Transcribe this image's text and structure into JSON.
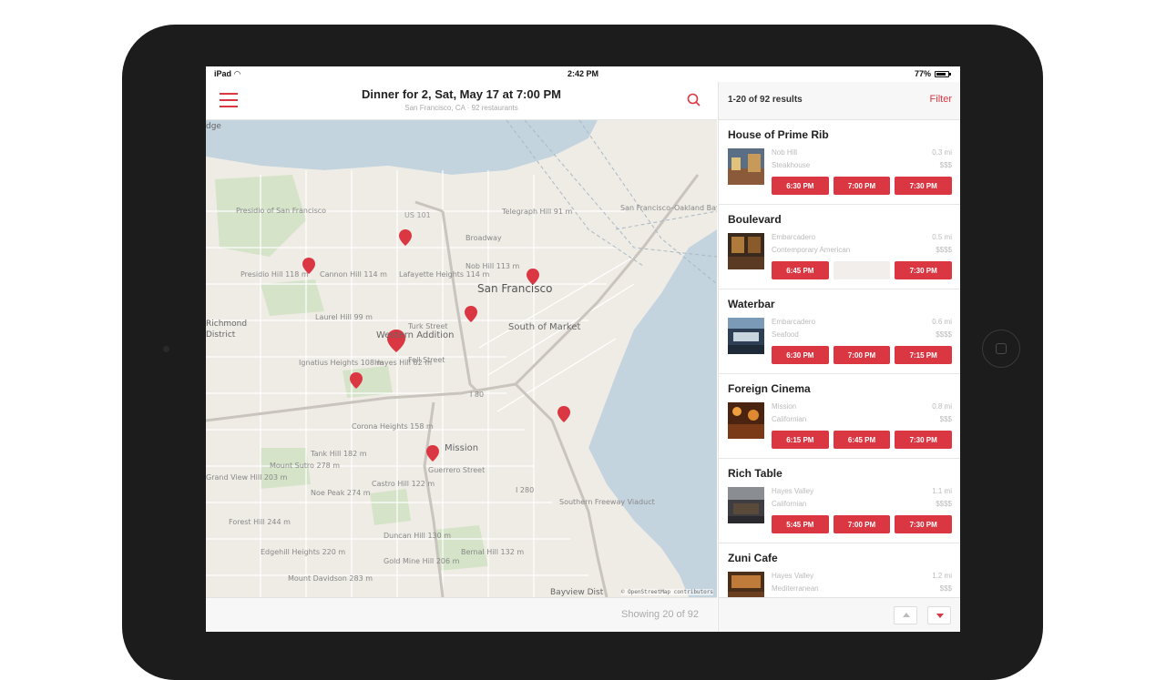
{
  "status_bar": {
    "device": "iPad",
    "time": "2:42 PM",
    "battery": "77%"
  },
  "header": {
    "title": "Dinner for 2, Sat, May 17 at 7:00 PM",
    "subtitle": "San Francisco, CA · 92 restaurants"
  },
  "map": {
    "labels": {
      "presidio": "Presidio of San Francisco",
      "us101": "US 101",
      "telegraph": "Telegraph Hill 91 m",
      "broadway": "Broadway",
      "bay_bridge": "San Francisco–Oakland Bay Bridge West Span",
      "nob_hill": "Nob Hill 113 m",
      "san_francisco": "San Francisco",
      "lafayette": "Lafayette Heights 114 m",
      "cannon": "Cannon Hill 114 m",
      "presidio_hill": "Presidio Hill 118 m",
      "laurel": "Laurel Hill 99 m",
      "richmond": "Richmond District",
      "western_addition": "Western Addition",
      "south_of_market": "South of Market",
      "turk": "Turk Street",
      "fell": "Fell Street",
      "ignatius": "Ignatius Heights 108 m",
      "hayes": "Hayes Hill 82 m",
      "corona": "Corona Heights 158 m",
      "tank": "Tank Hill 182 m",
      "mission": "Mission",
      "guerrero": "Guerrero Street",
      "mount_sutro": "Mount Sutro 278 m",
      "grand_view": "Grand View Hill 203 m",
      "noe_peak": "Noe Peak 274 m",
      "castro": "Castro Hill 122 m",
      "forest": "Forest Hill 244 m",
      "duncan": "Duncan Hill 130 m",
      "gold_mine": "Gold Mine Hill 206 m",
      "bernal": "Bernal Hill 132 m",
      "edgehill": "Edgehill Heights 220 m",
      "davidson": "Mount Davidson 283 m",
      "southern": "Southern Freeway Viaduct",
      "bayview": "Bayview Dist",
      "i80": "I 80",
      "i280": "I 280",
      "dge": "dge"
    },
    "attribution": "© OpenStreetMap contributors"
  },
  "footer": {
    "showing": "Showing 20 of 92"
  },
  "list_header": {
    "results": "1-20 of 92 results",
    "filter": "Filter"
  },
  "restaurants": [
    {
      "name": "House of Prime Rib",
      "neighborhood": "Nob Hill",
      "distance": "0.3 mi",
      "cuisine": "Steakhouse",
      "price": "$$$",
      "slots": [
        "6:30 PM",
        "7:00 PM",
        "7:30 PM"
      ]
    },
    {
      "name": "Boulevard",
      "neighborhood": "Embarcadero",
      "distance": "0.5 mi",
      "cuisine": "Contemporary American",
      "price": "$$$$",
      "slots": [
        "6:45 PM",
        "",
        "7:30 PM"
      ]
    },
    {
      "name": "Waterbar",
      "neighborhood": "Embarcadero",
      "distance": "0.6 mi",
      "cuisine": "Seafood",
      "price": "$$$$",
      "slots": [
        "6:30 PM",
        "7:00 PM",
        "7:15 PM"
      ]
    },
    {
      "name": "Foreign Cinema",
      "neighborhood": "Mission",
      "distance": "0.8 mi",
      "cuisine": "Californian",
      "price": "$$$",
      "slots": [
        "6:15 PM",
        "6:45 PM",
        "7:30 PM"
      ]
    },
    {
      "name": "Rich Table",
      "neighborhood": "Hayes Valley",
      "distance": "1.1 mi",
      "cuisine": "Californian",
      "price": "$$$$",
      "slots": [
        "5:45 PM",
        "7:00 PM",
        "7:30 PM"
      ]
    },
    {
      "name": "Zuni Cafe",
      "neighborhood": "Hayes Valley",
      "distance": "1.2 mi",
      "cuisine": "Mediterranean",
      "price": "$$$",
      "slots": [
        "",
        "",
        ""
      ]
    }
  ],
  "colors": {
    "accent": "#da3743",
    "map_bg": "#efece6",
    "water": "#c4d4df",
    "park": "#d5e3c8"
  },
  "icons": [
    "menu-icon",
    "search-icon",
    "wifi-icon",
    "battery-icon",
    "map-pin-icon",
    "arrow-up-icon",
    "arrow-down-icon"
  ]
}
